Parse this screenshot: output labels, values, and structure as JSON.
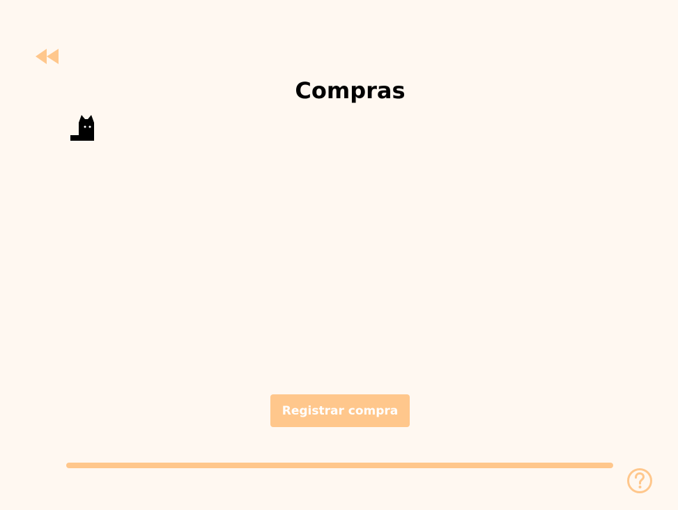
{
  "header": {
    "title": "Compras",
    "back_icon": "rewind-icon"
  },
  "logo": {
    "icon": "cat-icon"
  },
  "actions": {
    "register_label": "Registrar compra"
  },
  "footer": {
    "help_icon": "help-circle-icon"
  },
  "colors": {
    "background": "#fff8f1",
    "accent": "#ffc78c",
    "text": "#000000",
    "button_text": "#ffffff"
  }
}
